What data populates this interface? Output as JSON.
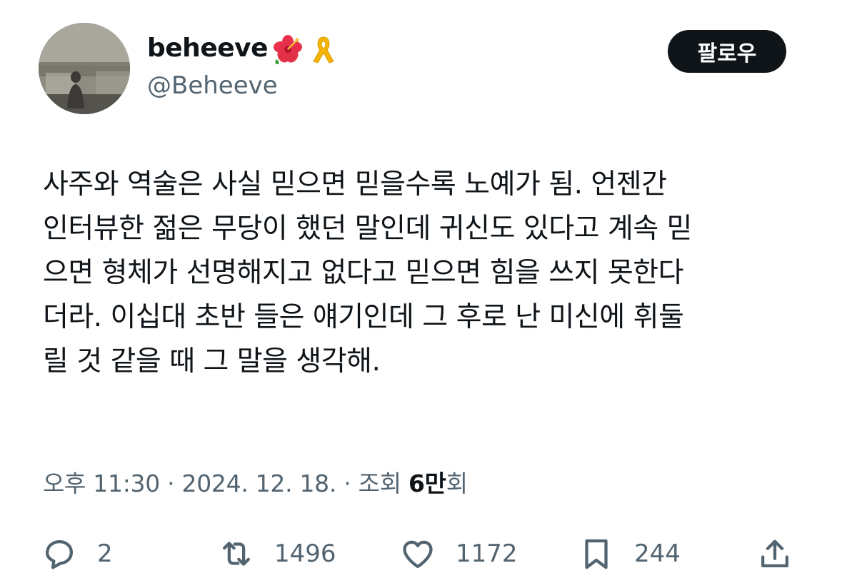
{
  "author": {
    "display_name": "beheeve",
    "handle": "@Beheeve",
    "badges": [
      "hibiscus-emoji",
      "yellow-ribbon-emoji"
    ]
  },
  "follow_button": {
    "label": "팔로우"
  },
  "tweet": {
    "lines": [
      "사주와 역술은 사실 믿으면 믿을수록 노예가 됨. 언젠간",
      "인터뷰한 젊은 무당이 했던 말인데 귀신도 있다고 계속 믿",
      "으면 형체가 선명해지고 없다고 믿으면 힘을 쓰지 못한다",
      "더라. 이십대 초반 들은 얘기인데 그 후로 난 미신에 휘둘",
      "릴 것 같을 때 그 말을 생각해."
    ]
  },
  "meta": {
    "time": "오후 11:30",
    "separator": "·",
    "date": "2024. 12. 18.",
    "views_label": "조회",
    "views_value": "6만",
    "views_unit": "회"
  },
  "actions": {
    "reply": {
      "icon": "reply-icon",
      "count": "2"
    },
    "retweet": {
      "icon": "retweet-icon",
      "count": "1496"
    },
    "like": {
      "icon": "heart-icon",
      "count": "1172"
    },
    "bookmark": {
      "icon": "bookmark-icon",
      "count": "244"
    },
    "share": {
      "icon": "share-icon"
    }
  },
  "colors": {
    "text_primary": "#0f1419",
    "text_secondary": "#536471",
    "follow_button_bg": "#0f1419",
    "follow_button_text": "#ffffff",
    "background": "#ffffff"
  }
}
